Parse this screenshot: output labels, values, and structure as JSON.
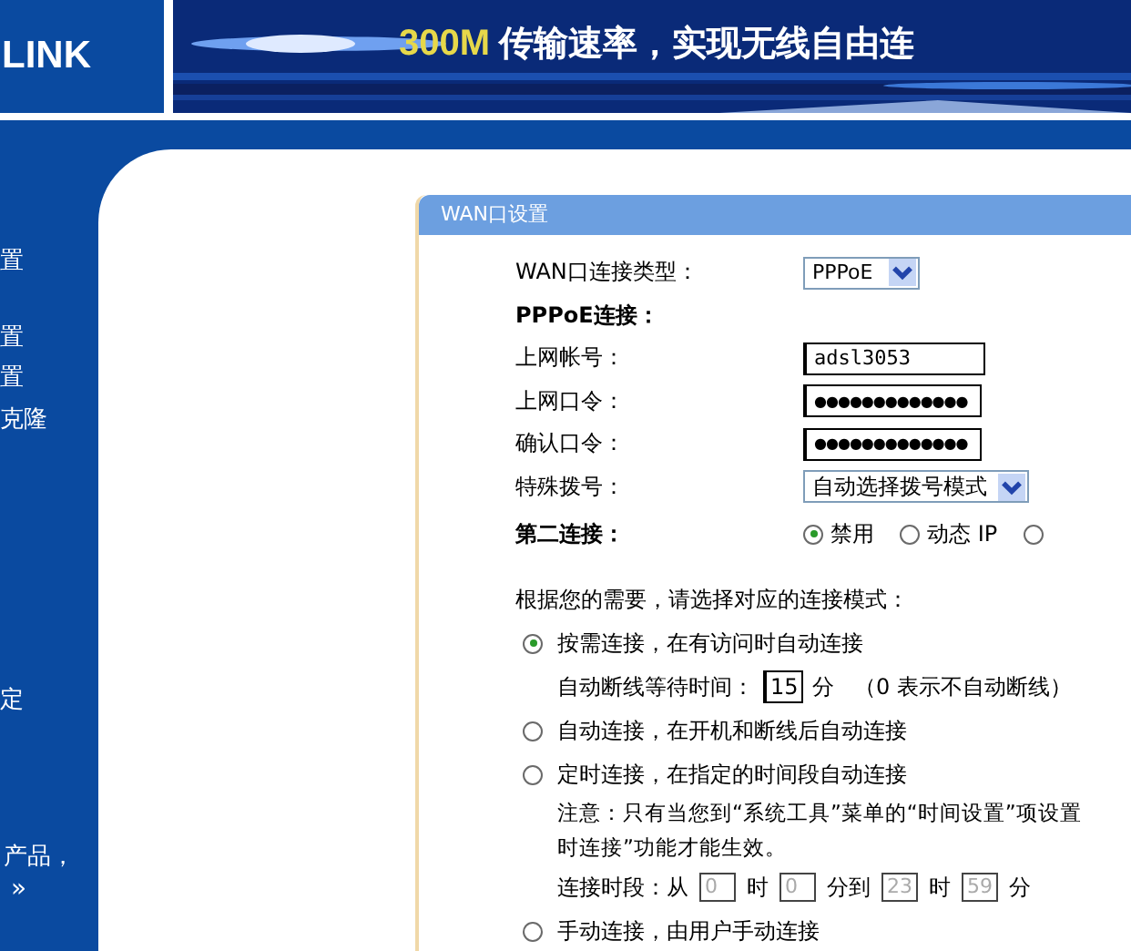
{
  "header": {
    "logo": "LINK",
    "slogan_highlight": "300M",
    "slogan": "传输速率，实现无线自由连"
  },
  "sidebar": {
    "items": [
      "置",
      "置",
      "置",
      "克隆",
      "定"
    ],
    "footer": "产品，",
    "more": "»"
  },
  "panel": {
    "title": "WAN口设置",
    "wan_type": {
      "label": "WAN口连接类型：",
      "value": "PPPoE"
    },
    "section": "PPPoE连接：",
    "account": {
      "label": "上网帐号：",
      "value": "adsl3053"
    },
    "password": {
      "label": "上网口令：",
      "value": "●●●●●●●●●●●●●"
    },
    "confirm": {
      "label": "确认口令：",
      "value": "●●●●●●●●●●●●●"
    },
    "dial": {
      "label": "特殊拨号：",
      "value": "自动选择拨号模式"
    },
    "second": {
      "label": "第二连接：",
      "options": [
        {
          "label": "禁用",
          "selected": true
        },
        {
          "label": "动态 IP",
          "selected": false
        },
        {
          "selected": false
        }
      ]
    },
    "mode_prompt": "根据您的需要，请选择对应的连接模式：",
    "modes": [
      {
        "label": "按需连接，在有访问时自动连接",
        "selected": true,
        "idle": {
          "label": "自动断线等待时间：",
          "value": "15",
          "unit": "分",
          "hint": "（0 表示不自动断线）"
        }
      },
      {
        "label": "自动连接，在开机和断线后自动连接",
        "selected": false
      },
      {
        "label": "定时连接，在指定的时间段自动连接",
        "selected": false,
        "note": [
          "注意：只有当您到“系统工具”菜单的“时间设置”项设置",
          "时连接”功能才能生效。"
        ],
        "period": {
          "label": "连接时段：从",
          "from_h": "0",
          "h1": "时",
          "from_m": "0",
          "m1": "分到",
          "to_h": "23",
          "h2": "时",
          "to_m": "59",
          "m2": "分"
        }
      },
      {
        "label": "手动连接，由用户手动连接",
        "selected": false
      }
    ]
  }
}
